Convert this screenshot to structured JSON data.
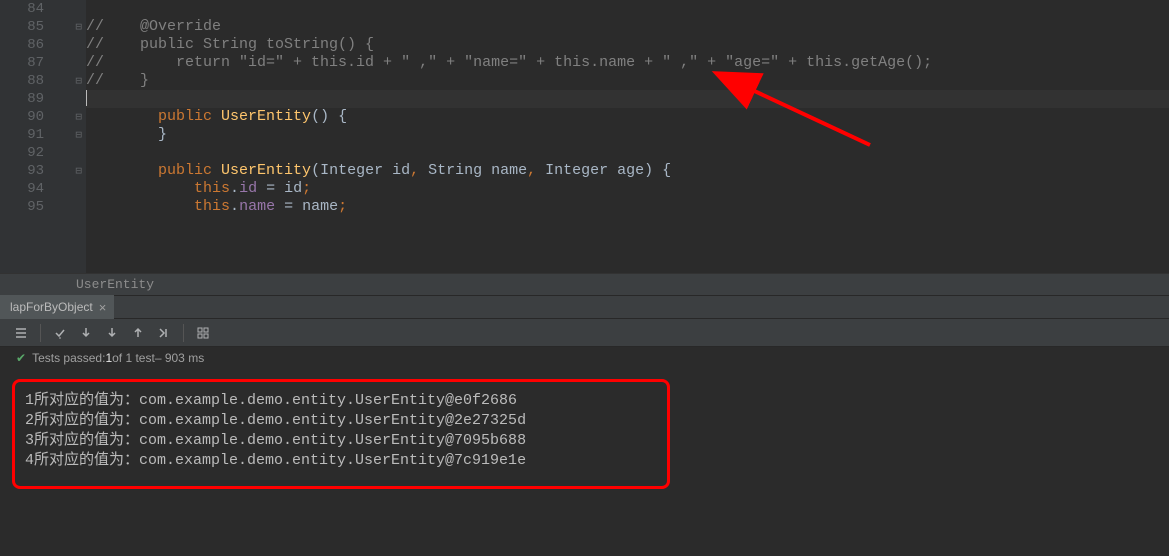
{
  "gutter": {
    "lines": [
      "84",
      "85",
      "86",
      "87",
      "88",
      "89",
      "90",
      "91",
      "92",
      "93",
      "94",
      "95"
    ]
  },
  "code": {
    "l84": "",
    "l85_a": "//",
    "l85_b": "    @Override",
    "l86_a": "//",
    "l86_b": "    public String toString() {",
    "l87_a": "//",
    "l87_b": "        return \"id=\" + this.id + \" ,\" + \"name=\" + this.name + \" ,\" + \"age=\" + this.getAge();",
    "l88_a": "//",
    "l88_b": "    }",
    "l89": "",
    "l90_pub": "public",
    "l90_cls": " UserEntity",
    "l90_tail": "() {",
    "l91": "        }",
    "l92": "",
    "l93_pub": "public",
    "l93_cls": " UserEntity",
    "l93_p1": "(Integer id",
    "l93_c1": ",",
    "l93_p2": " String name",
    "l93_c2": ",",
    "l93_p3": " Integer age) {",
    "l94_this": "this",
    "l94_dot": ".",
    "l94_fld": "id",
    "l94_eq": " = id",
    "l94_semi": ";",
    "l95_this": "this",
    "l95_dot": ".",
    "l95_fld": "name",
    "l95_eq": " = name",
    "l95_semi": ";"
  },
  "breadcrumb": {
    "path": "UserEntity"
  },
  "tab": {
    "name": "lapForByObject"
  },
  "status": {
    "label_pre": "Tests passed:",
    "count": " 1 ",
    "label_mid": "of 1 test",
    "time": " – 903 ms"
  },
  "console": {
    "lines": [
      "1所对应的值为：com.example.demo.entity.UserEntity@e0f2686",
      "2所对应的值为：com.example.demo.entity.UserEntity@2e27325d",
      "3所对应的值为：com.example.demo.entity.UserEntity@7095b688",
      "4所对应的值为：com.example.demo.entity.UserEntity@7c919e1e"
    ]
  }
}
